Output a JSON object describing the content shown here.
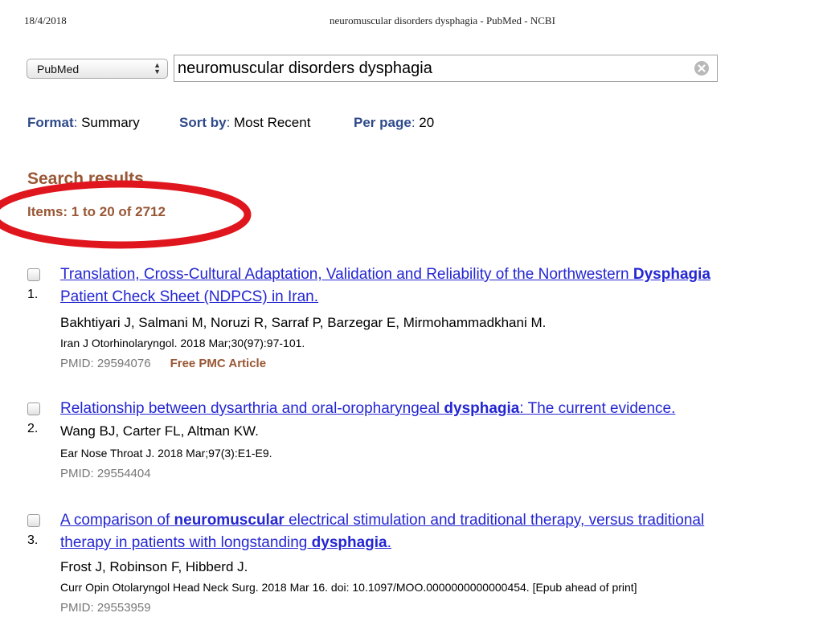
{
  "pdf_header": {
    "date": "18/4/2018",
    "title": "neuromuscular disorders dysphagia - PubMed - NCBI"
  },
  "search": {
    "database": "PubMed",
    "query": "neuromuscular disorders dysphagia",
    "clear_icon": "clear-x-circle-icon"
  },
  "display_settings": {
    "format_key": "Format",
    "format_value": "Summary",
    "sort_key": "Sort by",
    "sort_value": "Most Recent",
    "per_page_key": "Per page",
    "per_page_value": "20"
  },
  "results": {
    "heading": "Search results",
    "count": "Items: 1 to 20 of 2712",
    "items": [
      {
        "number": "1.",
        "title_line1": [
          "Translation, Cross‐Cultural Adaptation, Validation and Reliability of the Northwestern ",
          "Dysphagia",
          ""
        ],
        "title_line2": "Patient Check Sheet (NDPCS) in Iran.",
        "authors": "Bakhtiyari J, Salmani M, Noruzi R, Sarraf P, Barzegar E, Mirmohammadkhani M.",
        "journal": "Iran J Otorhinolaryngol. 2018 Mar;30(97):97‐101.",
        "pmid": "PMID: 29594076",
        "free_pmc": "Free PMC Article"
      },
      {
        "number": "2.",
        "title_line1": [
          "Relationship between dysarthria and oral‐oropharyngeal ",
          "dysphagia",
          ": The current evidence."
        ],
        "authors": "Wang BJ, Carter FL, Altman KW.",
        "journal": "Ear Nose Throat J. 2018 Mar;97(3):E1‐E9.",
        "pmid": "PMID: 29554404"
      },
      {
        "number": "3.",
        "title_line1": [
          "A comparison of ",
          "neuromuscular",
          " electrical stimulation and traditional therapy, versus traditional"
        ],
        "title_line2": [
          "therapy in patients with longstanding ",
          "dysphagia",
          "."
        ],
        "authors": "Frost J, Robinson F, Hibberd J.",
        "journal": "Curr Opin Otolaryngol Head Neck Surg. 2018 Mar 16. doi: 10.1097/MOO.0000000000000454. [Epub ahead of print]",
        "pmid": "PMID: 29553959"
      }
    ]
  },
  "annotation": {
    "color": "#e0161e",
    "shape": "oval around results count"
  }
}
